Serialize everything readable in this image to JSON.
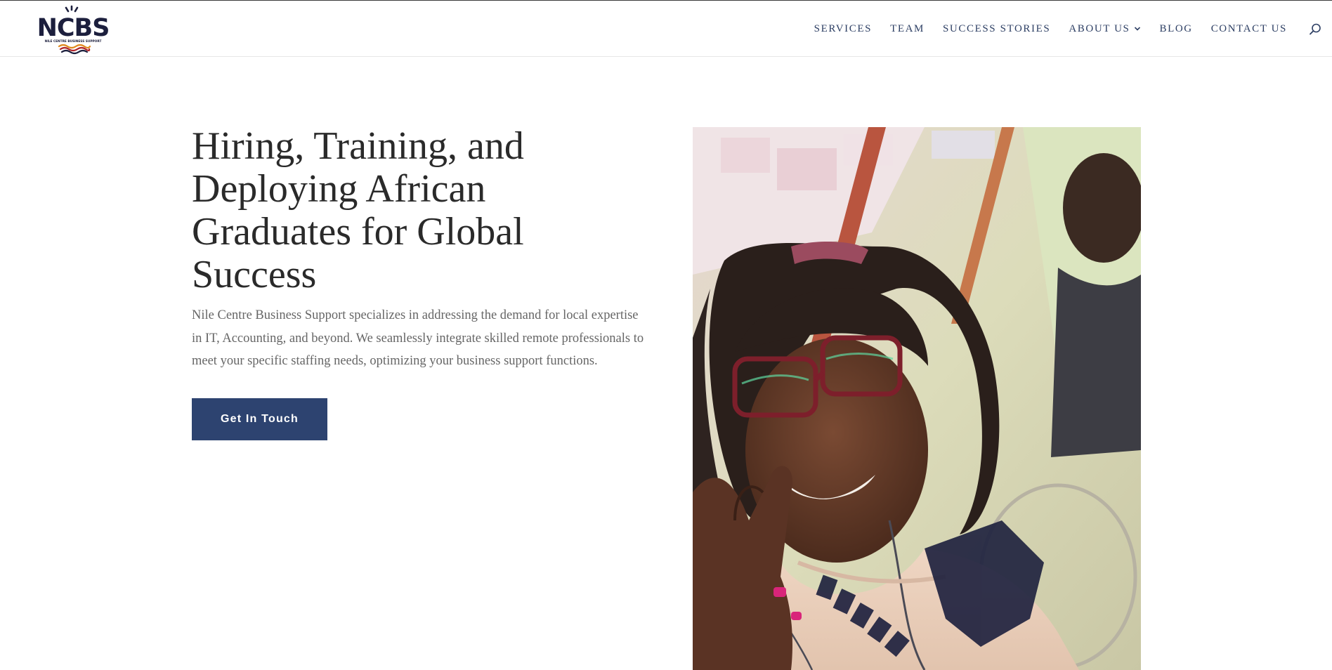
{
  "brand": {
    "logo_text": "NCBS",
    "logo_tagline": "NILE CENTRE BUSINESS SUPPORT",
    "colors": {
      "navy": "#1c1f3d",
      "accent_orange": "#e08a1e",
      "accent_red": "#b0252b"
    }
  },
  "nav": {
    "items": [
      {
        "label": "SERVICES"
      },
      {
        "label": "TEAM"
      },
      {
        "label": "SUCCESS STORIES"
      },
      {
        "label": "ABOUT US",
        "has_dropdown": true
      },
      {
        "label": "BLOG"
      },
      {
        "label": "CONTACT US"
      }
    ],
    "search_icon": "search-icon",
    "color": "#2c3e63"
  },
  "hero": {
    "title": "Hiring, Training, and Deploying African Graduates for Global Success",
    "description": "Nile Centre Business Support specializes in addressing the demand for local expertise in IT, Accounting, and beyond. We seamlessly integrate skilled remote professionals to meet your specific staffing needs, optimizing your business support functions.",
    "cta_label": "Get In Touch",
    "cta_color": "#2d4370"
  }
}
